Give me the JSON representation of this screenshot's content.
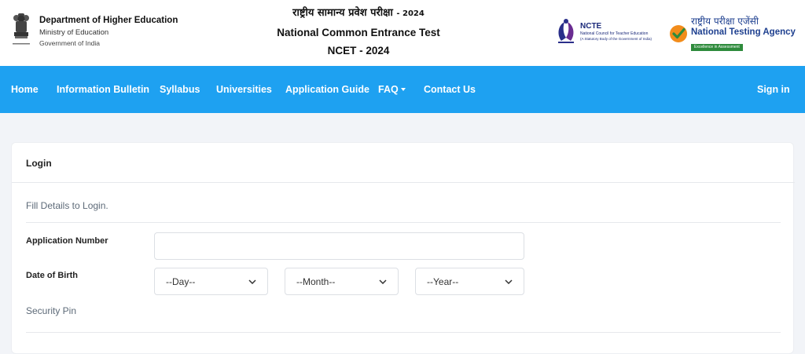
{
  "header": {
    "department": {
      "title": "Department of Higher Education",
      "ministry": "Ministry of Education",
      "government": "Government of India"
    },
    "exam": {
      "hindi_title": "राष्ट्रीय सामान्य प्रवेश परीक्षा",
      "hindi_year": "- 2024",
      "english_title": "National Common Entrance Test",
      "code": "NCET - 2024"
    },
    "ncte": {
      "name": "NCTE",
      "full_name": "National Council for Teacher Education",
      "statutory": "(A Statutory Body of the Government of India)"
    },
    "nta": {
      "hindi_name": "राष्ट्रीय परीक्षा एजेंसी",
      "name": "National Testing Agency",
      "tagline": "Excellence in Assessment"
    }
  },
  "nav": {
    "items": [
      "Home",
      "Information Bulletin",
      "Syllabus",
      "Universities",
      "Application Guide",
      "FAQ",
      "Contact Us"
    ],
    "signin": "Sign in"
  },
  "login": {
    "title": "Login",
    "hint": "Fill Details to Login.",
    "application_label": "Application Number",
    "application_value": "",
    "dob_label": "Date of Birth",
    "day": "--Day--",
    "month": "--Month--",
    "year": "--Year--",
    "pin_label": "Security Pin"
  },
  "colors": {
    "nav_bg": "#1ea1f1",
    "page_bg": "#f2f4f8"
  }
}
